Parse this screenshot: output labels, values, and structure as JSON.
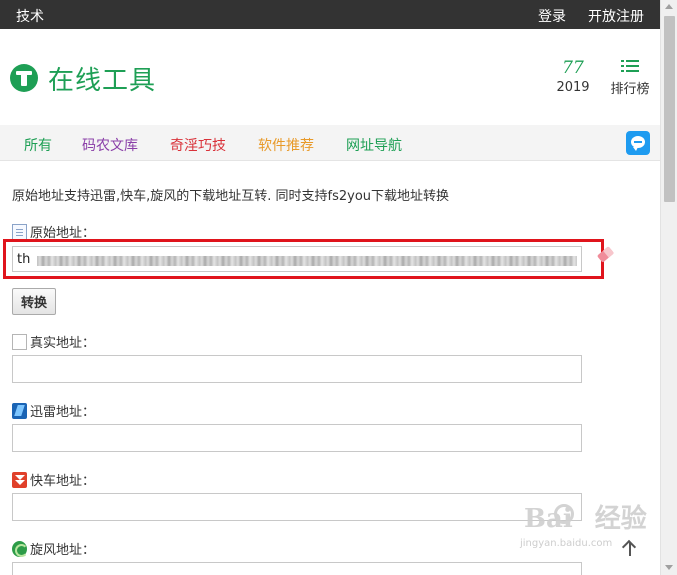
{
  "topbar": {
    "left_label": "技术",
    "login_label": "登录",
    "register_label": "开放注册"
  },
  "header": {
    "site_title": "在线工具",
    "count_value": "77",
    "year": "2019",
    "rank_label": "排行榜"
  },
  "nav": {
    "items": [
      {
        "label": "所有",
        "color": "#1e9f55"
      },
      {
        "label": "码农文库",
        "color": "#8a3fa8"
      },
      {
        "label": "奇淫巧技",
        "color": "#d9323a"
      },
      {
        "label": "软件推荐",
        "color": "#e89a2a"
      },
      {
        "label": "网址导航",
        "color": "#1e9f55"
      }
    ],
    "chat_icon": "chat-bubble-icon"
  },
  "main": {
    "description": "原始地址支持迅雷,快车,旋风的下载地址互转. 同时支持fs2you下载地址转换",
    "original": {
      "label": "原始地址：",
      "value": "th",
      "icon": "document-icon"
    },
    "convert_label": "转换",
    "real": {
      "label": "真实地址：",
      "value": "",
      "icon": "blank-document-icon"
    },
    "xunlei": {
      "label": "迅雷地址：",
      "value": "",
      "icon": "xunlei-icon"
    },
    "kuaiche": {
      "label": "快车地址：",
      "value": "",
      "icon": "kuaiche-icon"
    },
    "xuanfeng": {
      "label": "旋风地址：",
      "value": "",
      "icon": "xuanfeng-icon"
    }
  },
  "watermark": {
    "brand": "Bai",
    "brand2": "经验",
    "url": "jingyan.baidu.com"
  },
  "colors": {
    "brand_green": "#1e9f55",
    "highlight_red": "#e0141c",
    "topbar_bg": "#333333"
  }
}
